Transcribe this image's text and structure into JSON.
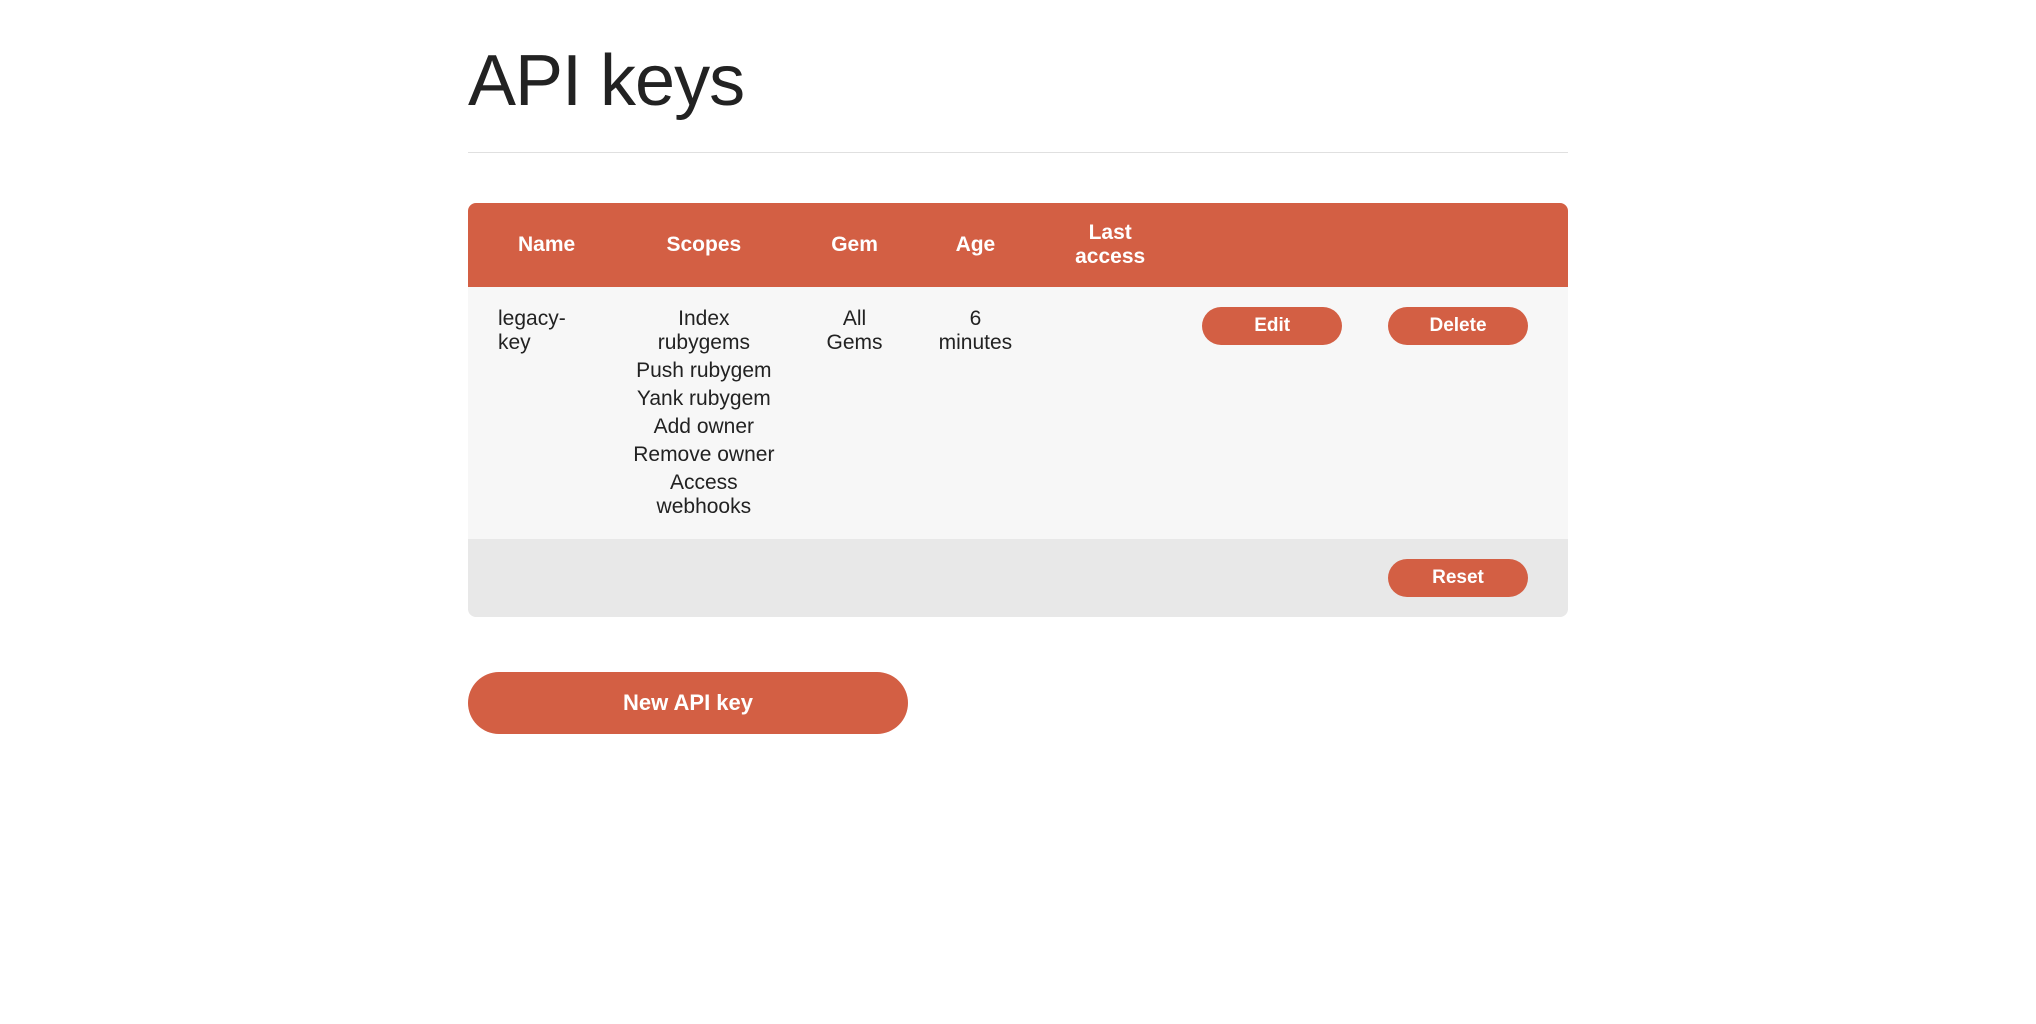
{
  "page": {
    "title": "API keys"
  },
  "table": {
    "headers": {
      "name": "Name",
      "scopes": "Scopes",
      "gem": "Gem",
      "age": "Age",
      "last_access": "Last access"
    },
    "rows": [
      {
        "name": "legacy-key",
        "scopes": [
          "Index rubygems",
          "Push rubygem",
          "Yank rubygem",
          "Add owner",
          "Remove owner",
          "Access webhooks"
        ],
        "gem": "All Gems",
        "age": "6 minutes",
        "last_access": ""
      }
    ]
  },
  "buttons": {
    "edit": "Edit",
    "delete": "Delete",
    "reset": "Reset",
    "new_api_key": "New API key"
  },
  "colors": {
    "accent": "#d35f44",
    "row_bg": "#f7f7f7",
    "footer_bg": "#e8e8e8"
  }
}
